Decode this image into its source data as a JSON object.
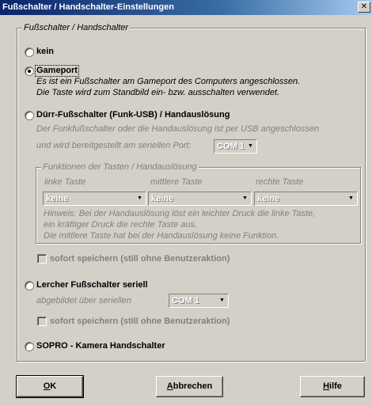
{
  "window": {
    "title": "Fußschalter / Handschalter-Einstellungen",
    "close_glyph": "✕"
  },
  "main_group": {
    "legend": "Fußschalter / Handschalter"
  },
  "options": {
    "none": {
      "label": "kein",
      "checked": false
    },
    "gameport": {
      "label": "Gameport",
      "checked": true,
      "desc_line1": "Es ist ein Fußschalter am Gameport des Computers angeschlossen.",
      "desc_line2": "Die Taste wird zum Standbild ein- bzw. ausschalten verwendet."
    },
    "duerr": {
      "label": "Dürr-Fußschalter (Funk-USB) / Handauslösung",
      "checked": false,
      "desc_line1": "Der Funkfußschalter oder die Handauslösung  ist per USB angeschlossen",
      "desc_line2": "und wird bereitgestellt am seriellen Port:",
      "port_value": "COM 1",
      "keys_group": {
        "legend": "Funktionen der Tasten / Handauslösung",
        "left_label": "linke Taste",
        "middle_label": "mittlere Taste",
        "right_label": "rechte Taste",
        "left_value": "keine",
        "middle_value": "keine",
        "right_value": "keine",
        "hint_line1": "Hinweis: Bei der Handauslösung löst ein leichter Druck die linke Taste,",
        "hint_line2": "ein kräftiger Druck die rechte Taste aus.",
        "hint_line3": "Die mittlere Taste hat bei der Handauslösung keine Funktion."
      },
      "save_label": "sofort speichern (still ohne Benutzeraktion)"
    },
    "lercher": {
      "label": "Lercher Fußschalter seriell",
      "checked": false,
      "desc": "abgebildet über seriellen",
      "port_value": "COM 1",
      "save_label": "sofort speichern (still ohne Benutzeraktion)"
    },
    "sopro": {
      "label": "SOPRO - Kamera Handschalter",
      "checked": false
    }
  },
  "buttons": {
    "ok": "OK",
    "cancel": "Abbrechen",
    "help": "Hilfe"
  },
  "icons": {
    "dropdown_arrow": "▼"
  },
  "colors": {
    "face": "#d4d0c8",
    "title_start": "#0a246a",
    "title_end": "#a6caf0",
    "disabled_text": "#808080"
  }
}
